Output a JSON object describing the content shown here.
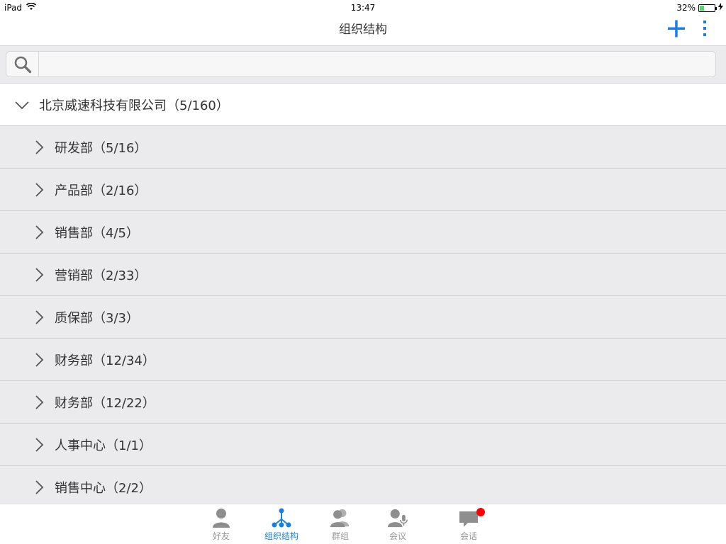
{
  "status": {
    "device": "iPad",
    "time": "13:47",
    "battery": "32%",
    "battery_level": 0.32,
    "wifi_icon": "wifi-icon",
    "charging_icon": "bolt-icon"
  },
  "nav": {
    "title": "组织结构",
    "add_icon": "plus-icon",
    "more_icon": "more-vertical-icon",
    "accent": "#1a7fe0"
  },
  "search": {
    "icon": "search-icon",
    "value": "",
    "placeholder": ""
  },
  "org": {
    "name": "北京威速科技有限公司（5/160）",
    "expanded": true,
    "departments": [
      {
        "name": "研发部（5/16）"
      },
      {
        "name": "产品部（2/16）"
      },
      {
        "name": "销售部（4/5）"
      },
      {
        "name": "营销部（2/33）"
      },
      {
        "name": "质保部（3/3）"
      },
      {
        "name": "财务部（12/34）"
      },
      {
        "name": "财务部（12/22）"
      },
      {
        "name": "人事中心（1/1）"
      },
      {
        "name": "销售中心（2/2）"
      }
    ]
  },
  "tabs": [
    {
      "label": "好友",
      "icon": "person-icon",
      "active": false
    },
    {
      "label": "组织结构",
      "icon": "org-tree-icon",
      "active": true
    },
    {
      "label": "群组",
      "icon": "group-icon",
      "active": false
    },
    {
      "label": "会议",
      "icon": "meeting-icon",
      "active": false
    },
    {
      "label": "会话",
      "icon": "chat-icon",
      "active": false,
      "badge": true
    }
  ],
  "colors": {
    "active_tab": "#1a7fe0",
    "inactive_tab": "#999999",
    "badge": "#ff0000",
    "list_bg": "#ebebee"
  }
}
